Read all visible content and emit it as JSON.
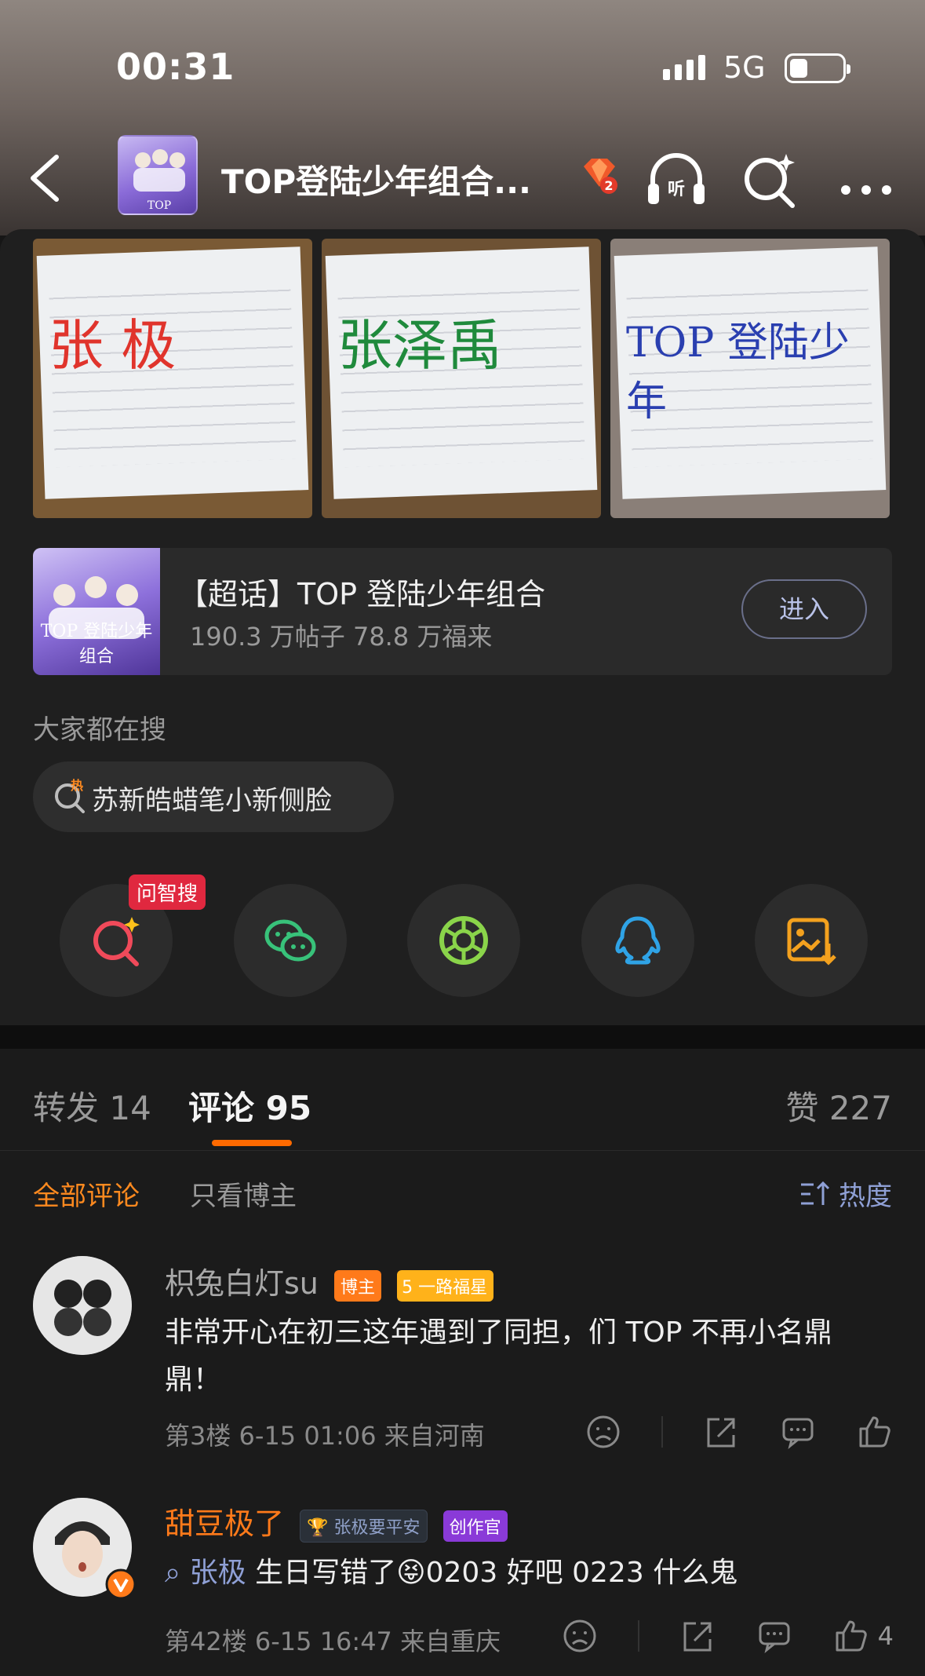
{
  "status": {
    "time": "00:31",
    "network": "5G"
  },
  "nav": {
    "title": "TOP登陆少年组合...",
    "rank": "2",
    "listen_label": "听"
  },
  "photos": [
    {
      "text": "张 极",
      "color": "#e0342c"
    },
    {
      "text": "张泽禹",
      "color": "#1f8a3c"
    },
    {
      "text": "TOP 登陆少年",
      "color": "#2a3fb0"
    }
  ],
  "topic": {
    "title": "【超话】TOP 登陆少年组合",
    "stats": "190.3 万帖子  78.8 万福来",
    "enter_label": "进入",
    "cover_text": "TOP 登陆少年组合"
  },
  "hot_search": {
    "label": "大家都在搜",
    "chip_text": "苏新皓蜡笔小新侧脸",
    "hot_mark": "热"
  },
  "share": {
    "ask_tag": "问智搜"
  },
  "tabs": {
    "repost": "转发 14",
    "comments": "评论 95",
    "likes": "赞 227"
  },
  "filters": {
    "all": "全部评论",
    "author_only": "只看博主",
    "sort": "热度"
  },
  "comments": [
    {
      "user": "枳兔白灯su",
      "badge_author": "博主",
      "badge_level": "5",
      "badge_fan": "一路福星",
      "text": "非常开心在初三这年遇到了同担，们 TOP 不再小名鼎鼎！",
      "meta": "第3楼  6-15 01:06  来自河南",
      "likes": ""
    },
    {
      "user": "甜豆极了",
      "badge_fan": "张极要平安",
      "badge_creator": "创作官",
      "mention": "张极",
      "text": "生日写错了😝0203 好吧 0223 什么鬼",
      "meta": "第42楼  6-15 16:47  来自重庆",
      "likes": "4"
    }
  ],
  "colors": {
    "accent": "#ff6a00",
    "topic_blue": "#8fa0d6",
    "background": "#1b1b1b"
  }
}
